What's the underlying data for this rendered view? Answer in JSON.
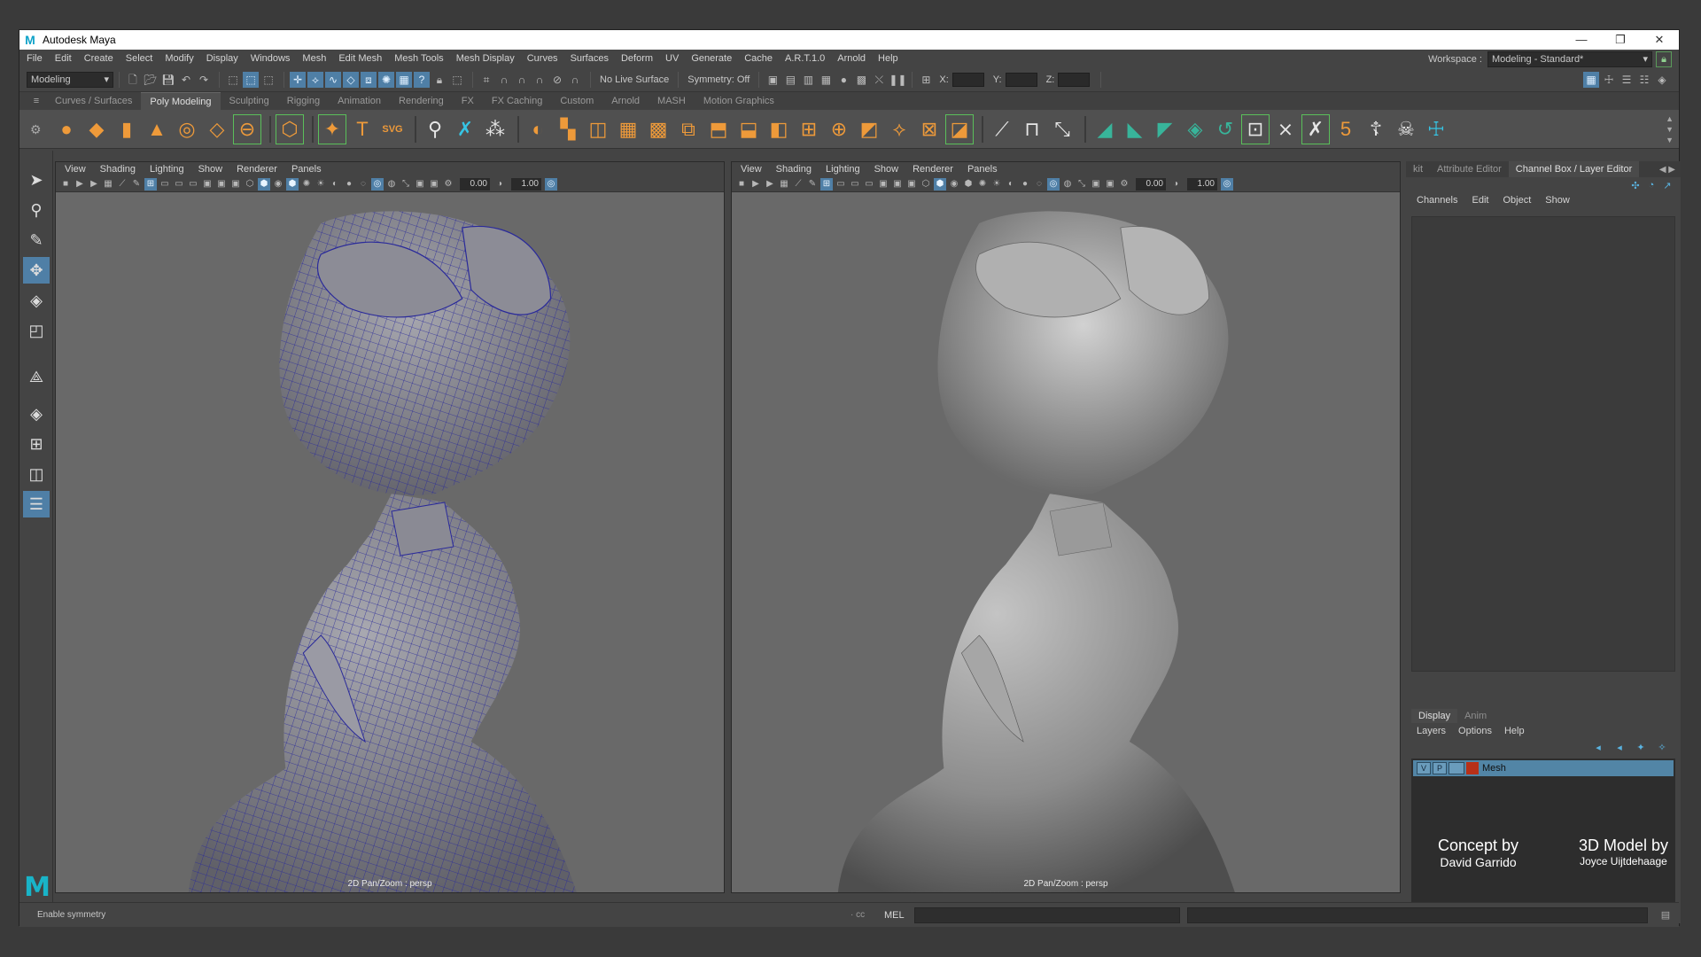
{
  "app": {
    "title": "Autodesk Maya",
    "window_controls": [
      "—",
      "❐",
      "✕"
    ]
  },
  "menubar": [
    "File",
    "Edit",
    "Create",
    "Select",
    "Modify",
    "Display",
    "Windows",
    "Mesh",
    "Edit Mesh",
    "Mesh Tools",
    "Mesh Display",
    "Curves",
    "Surfaces",
    "Deform",
    "UV",
    "Generate",
    "Cache",
    "A.R.T.1.0",
    "Arnold",
    "Help"
  ],
  "workspace": {
    "label": "Workspace :",
    "value": "Modeling - Standard*"
  },
  "statusline": {
    "mode": "Modeling",
    "live_surface": "No Live Surface",
    "symmetry": "Symmetry: Off",
    "x_label": "X:",
    "y_label": "Y:",
    "z_label": "Z:"
  },
  "shelf_tabs": [
    "Curves / Surfaces",
    "Poly Modeling",
    "Sculpting",
    "Rigging",
    "Animation",
    "Rendering",
    "FX",
    "FX Caching",
    "Custom",
    "Arnold",
    "MASH",
    "Motion Graphics"
  ],
  "shelf_active": "Poly Modeling",
  "shelf_text_icons": {
    "type": "T",
    "svg": "SVG",
    "badge": "5"
  },
  "viewports": [
    {
      "menu": [
        "View",
        "Shading",
        "Lighting",
        "Show",
        "Renderer",
        "Panels"
      ],
      "exposure": "0.00",
      "gamma": "1.00",
      "label": "2D Pan/Zoom : persp",
      "mode": "wireframe-on-shaded"
    },
    {
      "menu": [
        "View",
        "Shading",
        "Lighting",
        "Show",
        "Renderer",
        "Panels"
      ],
      "exposure": "0.00",
      "gamma": "1.00",
      "label": "2D Pan/Zoom : persp",
      "mode": "smooth-shaded"
    }
  ],
  "right_panel": {
    "tabs": [
      "kit",
      "Attribute Editor",
      "Channel Box / Layer Editor"
    ],
    "active_tab": "Channel Box / Layer Editor",
    "channel_menu": [
      "Channels",
      "Edit",
      "Object",
      "Show"
    ],
    "layer_tabs": [
      "Display",
      "Anim"
    ],
    "layer_menu": [
      "Layers",
      "Options",
      "Help"
    ],
    "layer": {
      "v": "V",
      "p": "P",
      "name": "Mesh",
      "color": "#b83018"
    }
  },
  "credits": {
    "concept_label": "Concept by",
    "concept_name": "David Garrido",
    "model_label": "3D Model by",
    "model_name": "Joyce Uijtdehaage"
  },
  "helpline": {
    "text": "Enable symmetry",
    "cc": "· cc",
    "mel": "MEL"
  },
  "colors": {
    "accent": "#4f7fa6",
    "layer_selected": "#5285a6",
    "wire": "#2a2a9a"
  }
}
